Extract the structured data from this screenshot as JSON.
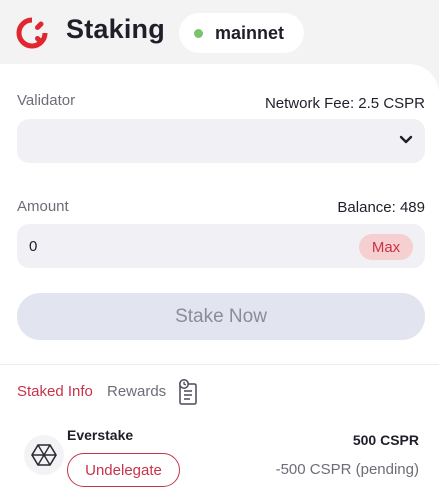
{
  "header": {
    "title": "Staking",
    "network": {
      "label": "mainnet",
      "status_color": "#7cc26a"
    },
    "logo_icon": "casper-logo",
    "brand_color": "#e0262f"
  },
  "form": {
    "validator_label": "Validator",
    "network_fee": "Network Fee: 2.5 CSPR",
    "validator_value": "",
    "amount_label": "Amount",
    "balance": "Balance: 489",
    "amount_value": "0",
    "max_label": "Max",
    "stake_button_label": "Stake Now"
  },
  "tabs": {
    "staked_info": "Staked Info",
    "rewards": "Rewards",
    "history_icon": "history-icon"
  },
  "staked": [
    {
      "validator_name": "Everstake",
      "validator_icon": "everstake-icon",
      "action_label": "Undelegate",
      "amount": "500 CSPR",
      "pending": "-500 CSPR (pending)"
    }
  ],
  "colors": {
    "accent": "#c8334a",
    "max_bg": "#f6cfd0",
    "disabled_button": "#e2e4ef"
  }
}
